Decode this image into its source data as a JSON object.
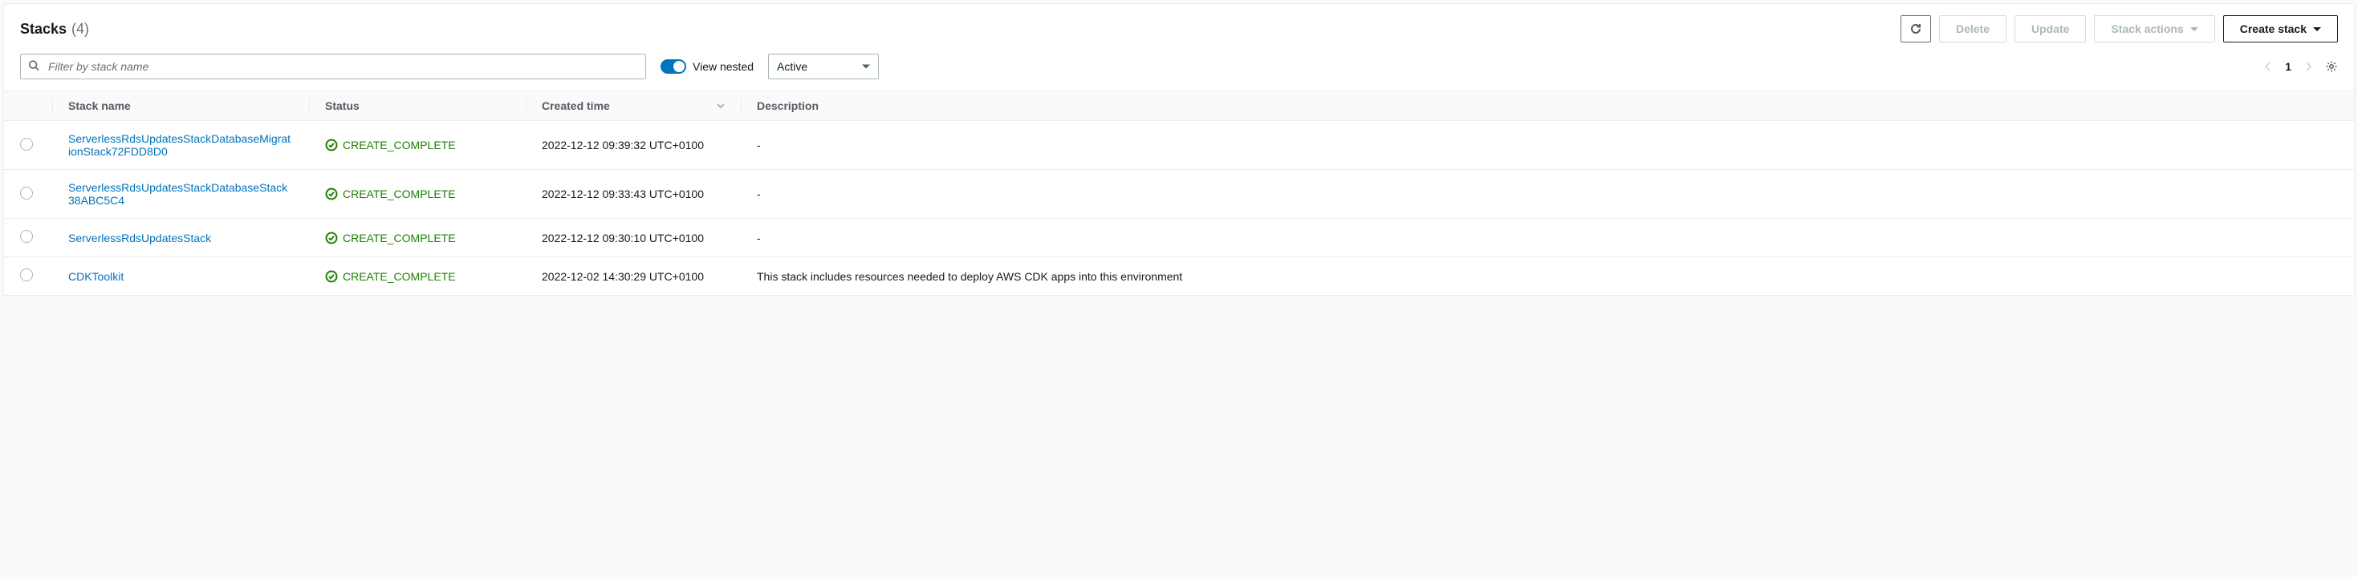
{
  "header": {
    "title": "Stacks",
    "count": "(4)",
    "refresh_label": "Refresh",
    "delete_label": "Delete",
    "update_label": "Update",
    "stack_actions_label": "Stack actions",
    "create_stack_label": "Create stack"
  },
  "filter": {
    "search_placeholder": "Filter by stack name",
    "view_nested_label": "View nested",
    "status_selected": "Active",
    "page_number": "1"
  },
  "columns": {
    "name": "Stack name",
    "status": "Status",
    "created": "Created time",
    "description": "Description"
  },
  "rows": [
    {
      "name": "ServerlessRdsUpdatesStackDatabaseMigrationStack72FDD8D0",
      "status": "CREATE_COMPLETE",
      "created": "2022-12-12 09:39:32 UTC+0100",
      "description": "-"
    },
    {
      "name": "ServerlessRdsUpdatesStackDatabaseStack38ABC5C4",
      "status": "CREATE_COMPLETE",
      "created": "2022-12-12 09:33:43 UTC+0100",
      "description": "-"
    },
    {
      "name": "ServerlessRdsUpdatesStack",
      "status": "CREATE_COMPLETE",
      "created": "2022-12-12 09:30:10 UTC+0100",
      "description": "-"
    },
    {
      "name": "CDKToolkit",
      "status": "CREATE_COMPLETE",
      "created": "2022-12-02 14:30:29 UTC+0100",
      "description": "This stack includes resources needed to deploy AWS CDK apps into this environment"
    }
  ]
}
